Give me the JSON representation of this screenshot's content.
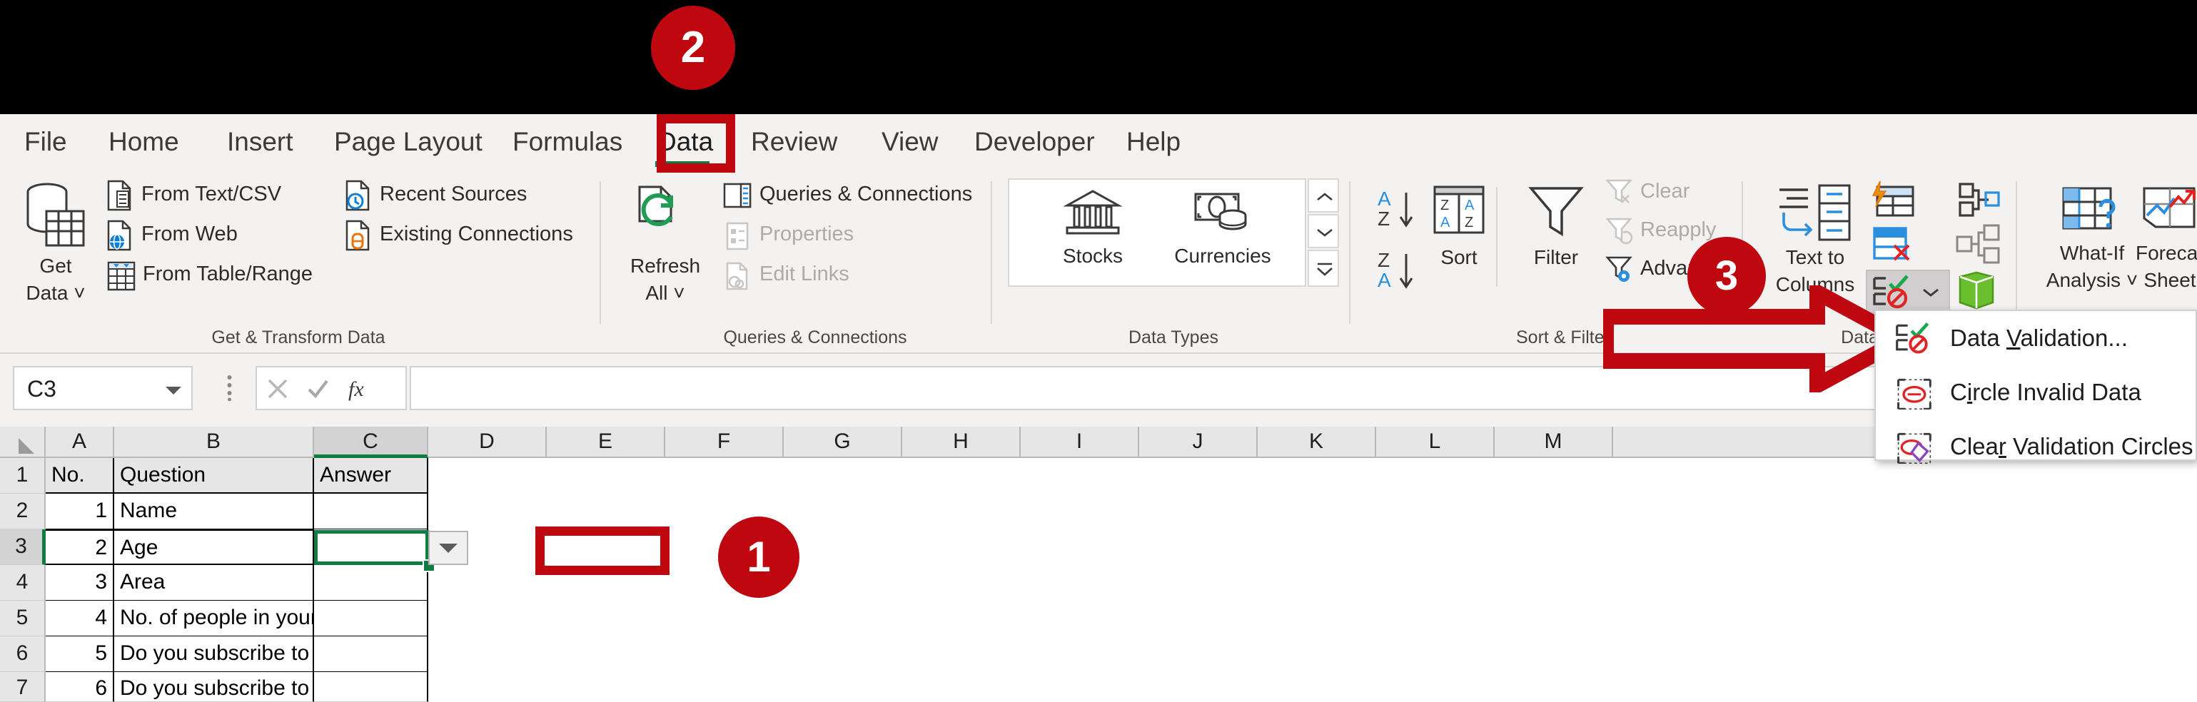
{
  "app": {
    "name": "Microsoft Excel",
    "ribbon_tab_active": "Data"
  },
  "ribbon_tabs": [
    {
      "label": "File"
    },
    {
      "label": "Home"
    },
    {
      "label": "Insert"
    },
    {
      "label": "Page Layout"
    },
    {
      "label": "Formulas"
    },
    {
      "label": "Data"
    },
    {
      "label": "Review"
    },
    {
      "label": "View"
    },
    {
      "label": "Developer"
    },
    {
      "label": "Help"
    }
  ],
  "ribbon": {
    "groups": [
      {
        "label": "Get & Transform Data"
      },
      {
        "label": "Queries & Connections"
      },
      {
        "label": "Data Types"
      },
      {
        "label": "Sort & Filter"
      },
      {
        "label": "Data Tools"
      }
    ],
    "get_transform": {
      "big_button": {
        "line1": "Get",
        "line2": "Data ˅",
        "icon": "get-data-icon"
      },
      "items": [
        {
          "label": "From Text/CSV",
          "icon": "from-text-csv-icon"
        },
        {
          "label": "From Web",
          "icon": "from-web-icon"
        },
        {
          "label": "From Table/Range",
          "icon": "from-table-range-icon"
        },
        {
          "label": "Recent Sources",
          "icon": "recent-sources-icon"
        },
        {
          "label": "Existing Connections",
          "icon": "existing-connections-icon"
        }
      ]
    },
    "queries_connections": {
      "big_button": {
        "line1": "Refresh",
        "line2": "All ˅",
        "icon": "refresh-all-icon"
      },
      "items": [
        {
          "label": "Queries & Connections",
          "icon": "queries-connections-icon",
          "disabled": false
        },
        {
          "label": "Properties",
          "icon": "properties-icon",
          "disabled": true
        },
        {
          "label": "Edit Links",
          "icon": "edit-links-icon",
          "disabled": true
        }
      ]
    },
    "data_types": {
      "items": [
        {
          "label": "Stocks",
          "icon": "stocks-icon"
        },
        {
          "label": "Currencies",
          "icon": "currencies-icon"
        }
      ],
      "gallery_scroll": [
        "scroll-up-icon",
        "scroll-down-icon",
        "gallery-more-icon"
      ]
    },
    "sort_filter": {
      "sort_asc": {
        "label": "A→Z",
        "icon": "sort-ascending-icon"
      },
      "sort_desc": {
        "label": "Z→A",
        "icon": "sort-descending-icon"
      },
      "sort": {
        "label": "Sort",
        "icon": "sort-icon"
      },
      "filter": {
        "label": "Filter",
        "icon": "filter-icon"
      },
      "items": [
        {
          "label": "Clear",
          "icon": "clear-filter-icon",
          "disabled": true
        },
        {
          "label": "Reapply",
          "icon": "reapply-filter-icon",
          "disabled": true
        },
        {
          "label": "Advanced",
          "icon": "advanced-filter-icon",
          "disabled": false
        }
      ]
    },
    "data_tools": {
      "text_to_columns": {
        "line1": "Text to",
        "line2": "Columns",
        "icon": "text-to-columns-icon"
      },
      "flash_fill": {
        "icon": "flash-fill-icon"
      },
      "remove_duplicates": {
        "icon": "remove-duplicates-icon"
      },
      "data_validation": {
        "icon": "data-validation-icon",
        "caret": "˅"
      },
      "consolidate": {
        "icon": "consolidate-icon"
      },
      "relationships": {
        "icon": "relationships-icon"
      },
      "manage_data_model": {
        "icon": "manage-data-model-icon"
      }
    },
    "forecast": {
      "what_if": {
        "line1": "What-If",
        "line2": "Analysis ˅",
        "icon": "what-if-analysis-icon"
      },
      "forecast_sheet": {
        "line1": "Forecast",
        "line2": "Sheet",
        "icon": "forecast-sheet-icon"
      }
    }
  },
  "data_validation_menu": {
    "items": [
      {
        "label_pre": "Data ",
        "accel": "V",
        "label_post": "alidation...",
        "icon": "data-validation-icon"
      },
      {
        "label_pre": "C",
        "accel": "i",
        "label_post": "rcle Invalid Data",
        "icon": "circle-invalid-data-icon"
      },
      {
        "label_pre": "Clea",
        "accel": "r",
        "label_post": " Validation Circles",
        "icon": "clear-validation-circles-icon"
      }
    ]
  },
  "formula_bar": {
    "name_box_value": "C3",
    "cancel_icon": "cancel-icon",
    "enter_icon": "enter-icon",
    "function_icon": "insert-function-icon",
    "formula_value": ""
  },
  "sheet": {
    "column_headers": [
      "A",
      "B",
      "C",
      "D",
      "E",
      "F",
      "G",
      "H",
      "I",
      "J",
      "K",
      "L",
      "M"
    ],
    "selected_column": "C",
    "row_headers": [
      "1",
      "2",
      "3",
      "4",
      "5",
      "6",
      "7"
    ],
    "selected_row": "3",
    "header_row": {
      "a": "No.",
      "b": "Question",
      "c": "Answer"
    },
    "rows": [
      {
        "no": "1",
        "question": "Name",
        "answer": ""
      },
      {
        "no": "2",
        "question": "Age",
        "answer": ""
      },
      {
        "no": "3",
        "question": "Area",
        "answer": ""
      },
      {
        "no": "4",
        "question": "No. of people in your household",
        "answer": ""
      },
      {
        "no": "5",
        "question": "Do you subscribe to a newspaper",
        "answer": ""
      },
      {
        "no": "6",
        "question": "Do you subscribe to an OTT",
        "answer": ""
      }
    ],
    "active_cell": "C3"
  },
  "callouts": {
    "badges": [
      {
        "number": "1",
        "target": "active-cell-dropdown"
      },
      {
        "number": "2",
        "target": "data-tab"
      },
      {
        "number": "3",
        "target": "data-validation-button"
      }
    ],
    "accent_color": "#bf0710",
    "selection_color": "#107c41"
  }
}
